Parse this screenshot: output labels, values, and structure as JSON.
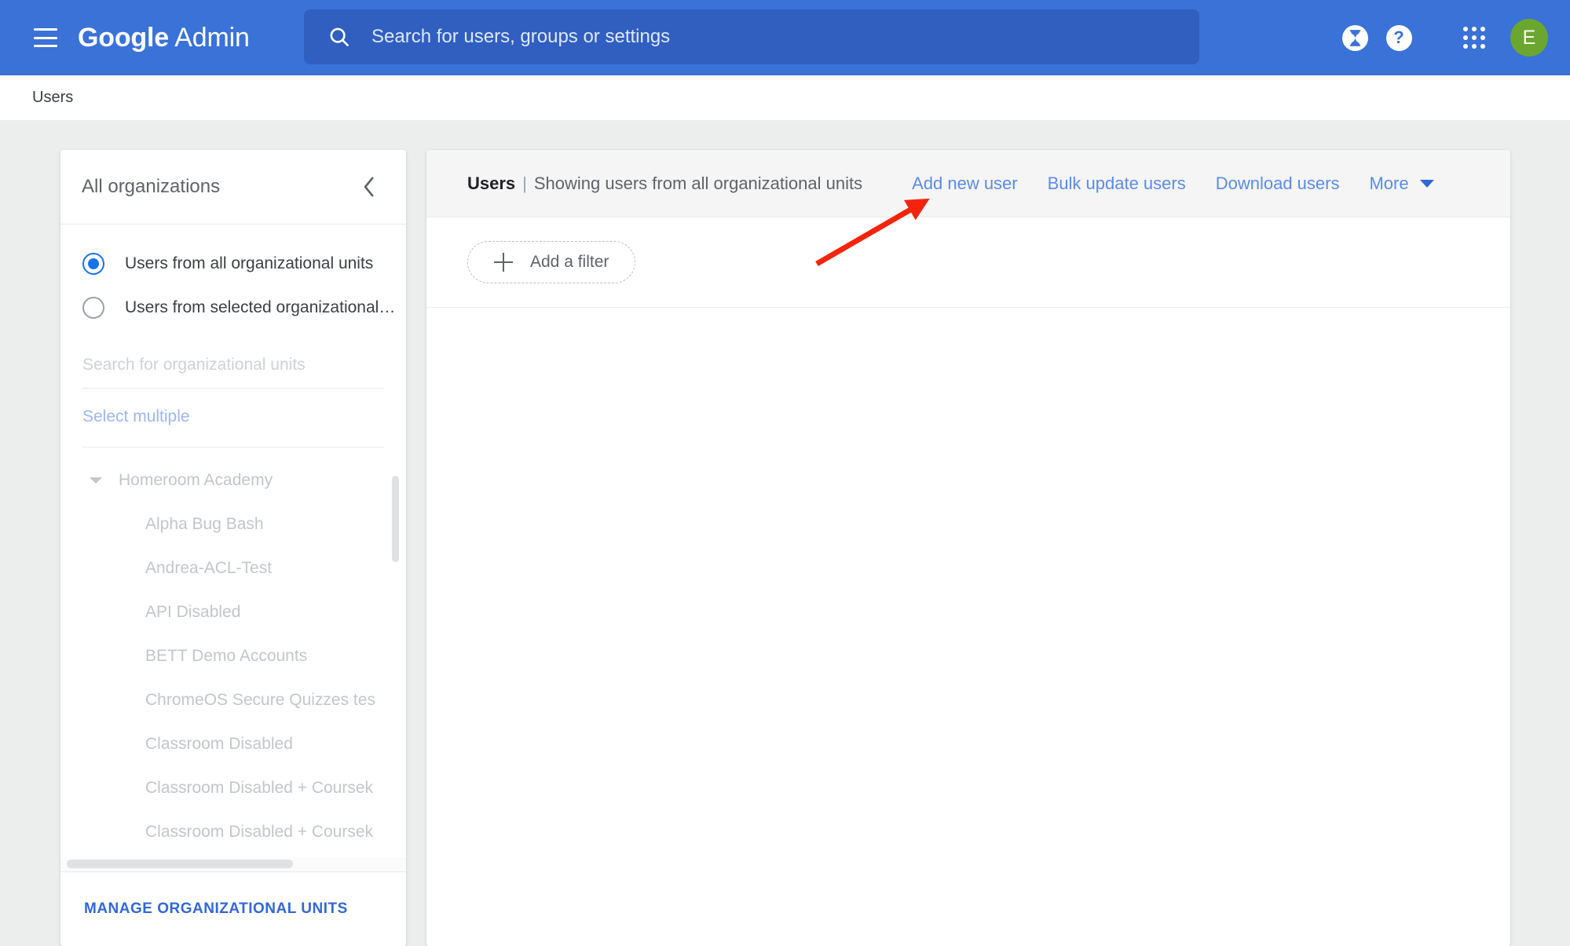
{
  "topbar": {
    "menu_icon": "hamburger-menu-icon",
    "brand_bold": "Google",
    "brand_regular": "Admin",
    "search": {
      "icon": "search-icon",
      "placeholder": "Search for users, groups or settings",
      "value": ""
    },
    "icons": [
      {
        "name": "trial-hourglass-icon",
        "glyph": "⧗"
      },
      {
        "name": "help-icon",
        "glyph": "?"
      },
      {
        "name": "apps-grid-icon",
        "glyph": "grid"
      }
    ],
    "avatar": {
      "name": "account-avatar",
      "initial": "E",
      "color": "#6ba72e"
    }
  },
  "breadcrumb": {
    "label": "Users"
  },
  "org_panel": {
    "title": "All organizations",
    "collapse_icon": "chevron-left-icon",
    "radios": [
      {
        "label": "Users from all organizational units",
        "selected": true
      },
      {
        "label": "Users from selected organizational…",
        "selected": false
      }
    ],
    "search_placeholder": "Search for organizational units",
    "search_value": "",
    "select_multiple": "Select multiple",
    "tree": [
      {
        "label": "Homeroom Academy",
        "level": 0,
        "expanded": true
      },
      {
        "label": "Alpha Bug Bash",
        "level": 1
      },
      {
        "label": "Andrea-ACL-Test",
        "level": 1
      },
      {
        "label": "API Disabled",
        "level": 1
      },
      {
        "label": "BETT Demo Accounts",
        "level": 1
      },
      {
        "label": "ChromeOS Secure Quizzes tes",
        "level": 1
      },
      {
        "label": "Classroom Disabled",
        "level": 1
      },
      {
        "label": "Classroom Disabled + Coursek",
        "level": 1
      },
      {
        "label": "Classroom Disabled + Coursek",
        "level": 1
      }
    ],
    "manage_link": "MANAGE ORGANIZATIONAL UNITS"
  },
  "main": {
    "title": "Users",
    "separator": "|",
    "subtitle": "Showing users from all organizational units",
    "actions": [
      {
        "label": "Add new user"
      },
      {
        "label": "Bulk update users"
      },
      {
        "label": "Download users"
      }
    ],
    "more": {
      "label": "More",
      "icon": "chevron-down-icon"
    },
    "filter": {
      "icon": "plus-icon",
      "label": "Add a filter"
    }
  },
  "annotation": {
    "arrow": {
      "name": "red-pointer-arrow",
      "color": "#f4240c",
      "target": "Add new user"
    }
  },
  "colors": {
    "topbar_blue": "#3a72d8",
    "search_blue": "#305fc0",
    "link_blue": "#5b8bea",
    "accent_blue": "#1a73e8",
    "page_grey": "#eceded",
    "card_head_grey": "#f5f5f5"
  }
}
